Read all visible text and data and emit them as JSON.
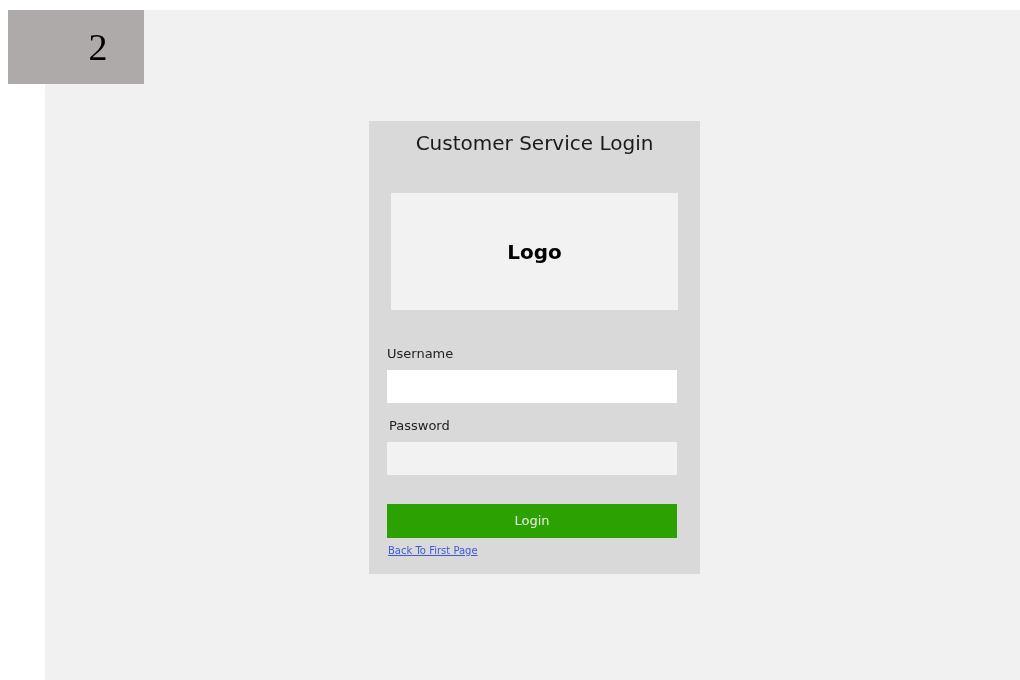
{
  "page_badge": "2",
  "login": {
    "title": "Customer Service Login",
    "logo": "Logo",
    "fields": [
      {
        "kind": "text",
        "label": "Username"
      },
      {
        "kind": "password",
        "label": "Password"
      }
    ],
    "button": "Login",
    "link": "Back To First Page"
  }
}
